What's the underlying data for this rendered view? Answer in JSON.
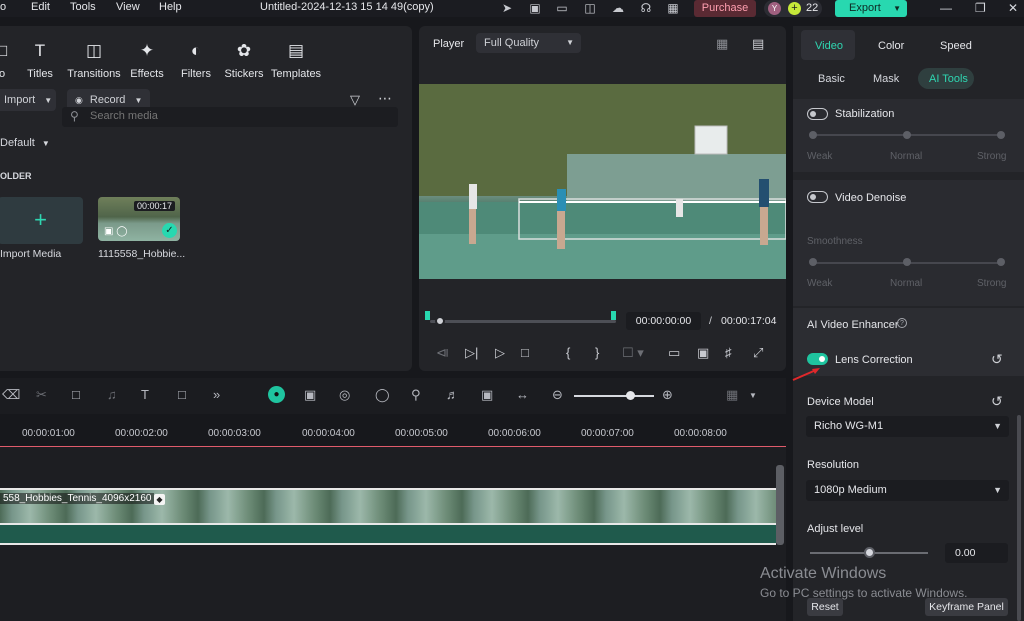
{
  "menubar": {
    "items": [
      "o",
      "Edit",
      "Tools",
      "View",
      "Help"
    ],
    "title": "Untitled-2024-12-13 15 14 49(copy)",
    "purchase_label": "Purchase",
    "credits_avatar": "Y",
    "credits_count": "22",
    "export_label": "Export"
  },
  "toolbar": {
    "tools": [
      "o",
      "Titles",
      "Transitions",
      "Effects",
      "Filters",
      "Stickers",
      "Templates"
    ]
  },
  "media": {
    "import_label": "Import",
    "record_label": "Record",
    "sort_label": "Default",
    "search_placeholder": "Search media",
    "folder_label": "OLDER",
    "import_media_label": "Import Media",
    "clip_duration": "00:00:17",
    "clip_name": "1115558_Hobbie..."
  },
  "player": {
    "label": "Player",
    "quality": "Full Quality",
    "current_time": "00:00:00:00",
    "separator": "/",
    "total_time": "00:00:17:04"
  },
  "timeline": {
    "ticks": [
      "00:00:01:00",
      "00:00:02:00",
      "00:00:03:00",
      "00:00:04:00",
      "00:00:05:00",
      "00:00:06:00",
      "00:00:07:00",
      "00:00:08:00"
    ],
    "clip_label": "558_Hobbies_Tennis_4096x2160",
    "zoom_level": 0.7
  },
  "right_panel": {
    "tabs": [
      "Video",
      "Color",
      "Speed"
    ],
    "active_tab": "Video",
    "subtabs": [
      "Basic",
      "Mask",
      "AI Tools"
    ],
    "active_subtab": "AI Tools",
    "stabilization": {
      "label": "Stabilization",
      "on": false,
      "levels": [
        "Weak",
        "Normal",
        "Strong"
      ]
    },
    "denoise": {
      "label": "Video Denoise",
      "on": false,
      "smoothness_label": "Smoothness",
      "levels": [
        "Weak",
        "Normal",
        "Strong"
      ]
    },
    "enhancer": {
      "label": "AI Video Enhancer",
      "lens_label": "Lens Correction",
      "lens_on": true,
      "device_model_label": "Device Model",
      "device_model_value": "Richo WG-M1",
      "resolution_label": "Resolution",
      "resolution_value": "1080p Medium",
      "adjust_label": "Adjust level",
      "adjust_value": "0.00",
      "adjust_fraction": 0.5
    },
    "reset_label": "Reset",
    "keyframe_label": "Keyframe Panel"
  },
  "watermark": {
    "line1": "Activate Windows",
    "line2": "Go to PC settings to activate Windows."
  },
  "colors": {
    "accent": "#28d8b0",
    "toggle_on": "#1fc49f",
    "playhead": "#e05b6b",
    "annotation_arrow": "#e0282b"
  }
}
